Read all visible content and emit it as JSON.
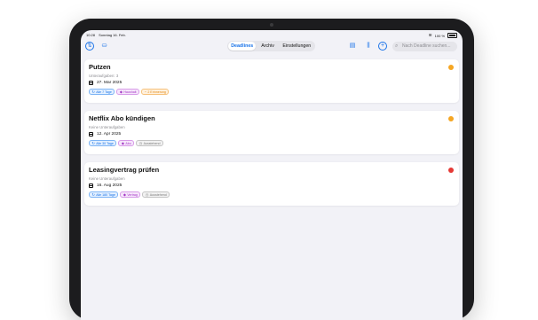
{
  "statusbar": {
    "time": "10:28",
    "date": "Sonntag 16. Feb.",
    "battery": "100 %"
  },
  "toolbar": {
    "tabs": [
      {
        "label": "Deadlines",
        "active": true
      },
      {
        "label": "Archiv",
        "active": false
      },
      {
        "label": "Einstellungen",
        "active": false
      }
    ],
    "search_placeholder": "Nach Deadline suchen..."
  },
  "deadlines": [
    {
      "title": "Putzen",
      "subtitle": "Unteraufgaben: 3",
      "date": "27. Mar 2025",
      "priority_color": "#f5a623",
      "tags": [
        {
          "label": "Alle 7 Tage",
          "style": "blue",
          "icon": "repeat-icon"
        },
        {
          "label": "Haushalt",
          "style": "purple",
          "icon": "tag-icon"
        },
        {
          "label": "2 Erinnerung",
          "style": "orange",
          "icon": "bell-icon"
        }
      ]
    },
    {
      "title": "Netflix Abo kündigen",
      "subtitle": "Keine Unteraufgaben",
      "date": "12. Apr 2025",
      "priority_color": "#f5a623",
      "tags": [
        {
          "label": "Alle 30 Tage",
          "style": "blue",
          "icon": "repeat-icon"
        },
        {
          "label": "Abo",
          "style": "purple",
          "icon": "tag-icon"
        },
        {
          "label": "Ausstehend",
          "style": "gray",
          "icon": "clock-icon"
        }
      ]
    },
    {
      "title": "Leasingvertrag prüfen",
      "subtitle": "Keine Unteraufgaben",
      "date": "16. Aug 2025",
      "priority_color": "#e53935",
      "tags": [
        {
          "label": "Alle 180 Tage",
          "style": "blue",
          "icon": "repeat-icon"
        },
        {
          "label": "Vertrag",
          "style": "purple",
          "icon": "tag-icon"
        },
        {
          "label": "Ausstehend",
          "style": "gray",
          "icon": "clock-icon"
        }
      ]
    }
  ]
}
